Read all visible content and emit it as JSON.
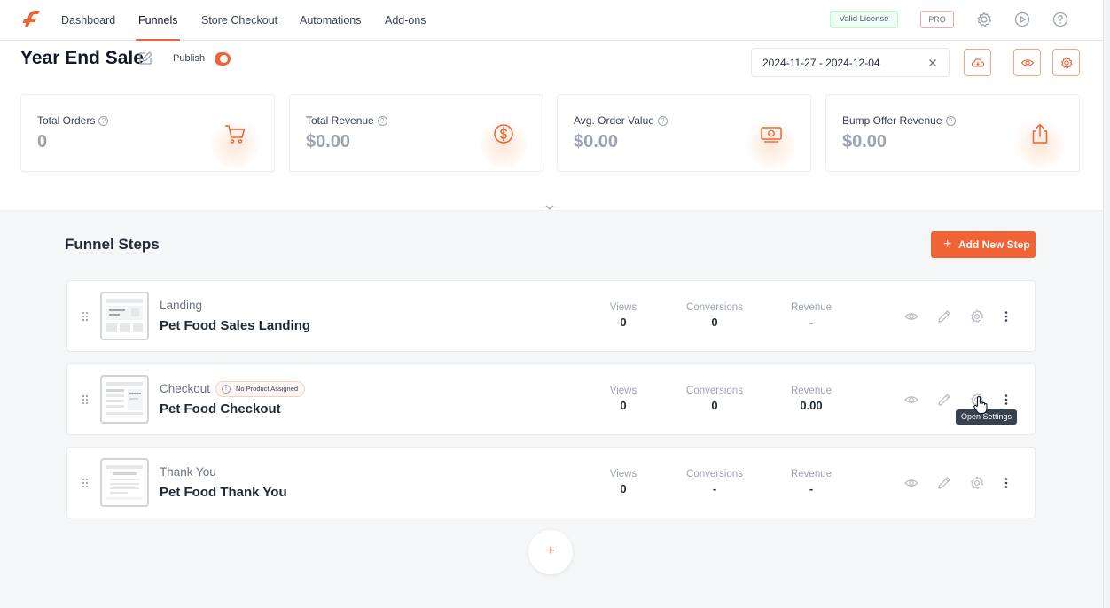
{
  "nav": {
    "items": [
      "Dashboard",
      "Funnels",
      "Store Checkout",
      "Automations",
      "Add-ons"
    ],
    "active": "Funnels",
    "license_badge": "Valid License",
    "pro_badge": "PRO"
  },
  "funnel": {
    "title": "Year End Sale",
    "publish_label": "Publish",
    "published": true
  },
  "date_range": "2024-11-27 - 2024-12-04",
  "stats": [
    {
      "label": "Total Orders",
      "value": "0",
      "icon": "cart-icon"
    },
    {
      "label": "Total Revenue",
      "value": "$0.00",
      "icon": "dollar-circle-icon"
    },
    {
      "label": "Avg. Order Value",
      "value": "$0.00",
      "icon": "money-icon"
    },
    {
      "label": "Bump Offer Revenue",
      "value": "$0.00",
      "icon": "share-icon"
    }
  ],
  "steps_section": {
    "title": "Funnel Steps",
    "add_button": "Add New Step"
  },
  "metric_labels": {
    "views": "Views",
    "conversions": "Conversions",
    "revenue": "Revenue"
  },
  "steps": [
    {
      "type": "Landing",
      "name": "Pet Food Sales Landing",
      "views": "0",
      "conversions": "0",
      "revenue": "-"
    },
    {
      "type": "Checkout",
      "name": "Pet Food Checkout",
      "badge": "No Product Assigned",
      "views": "0",
      "conversions": "0",
      "revenue": "0.00"
    },
    {
      "type": "Thank You",
      "name": "Pet Food Thank You",
      "views": "0",
      "conversions": "-",
      "revenue": "-"
    }
  ],
  "tooltip": "Open Settings",
  "colors": {
    "accent": "#f06335"
  }
}
